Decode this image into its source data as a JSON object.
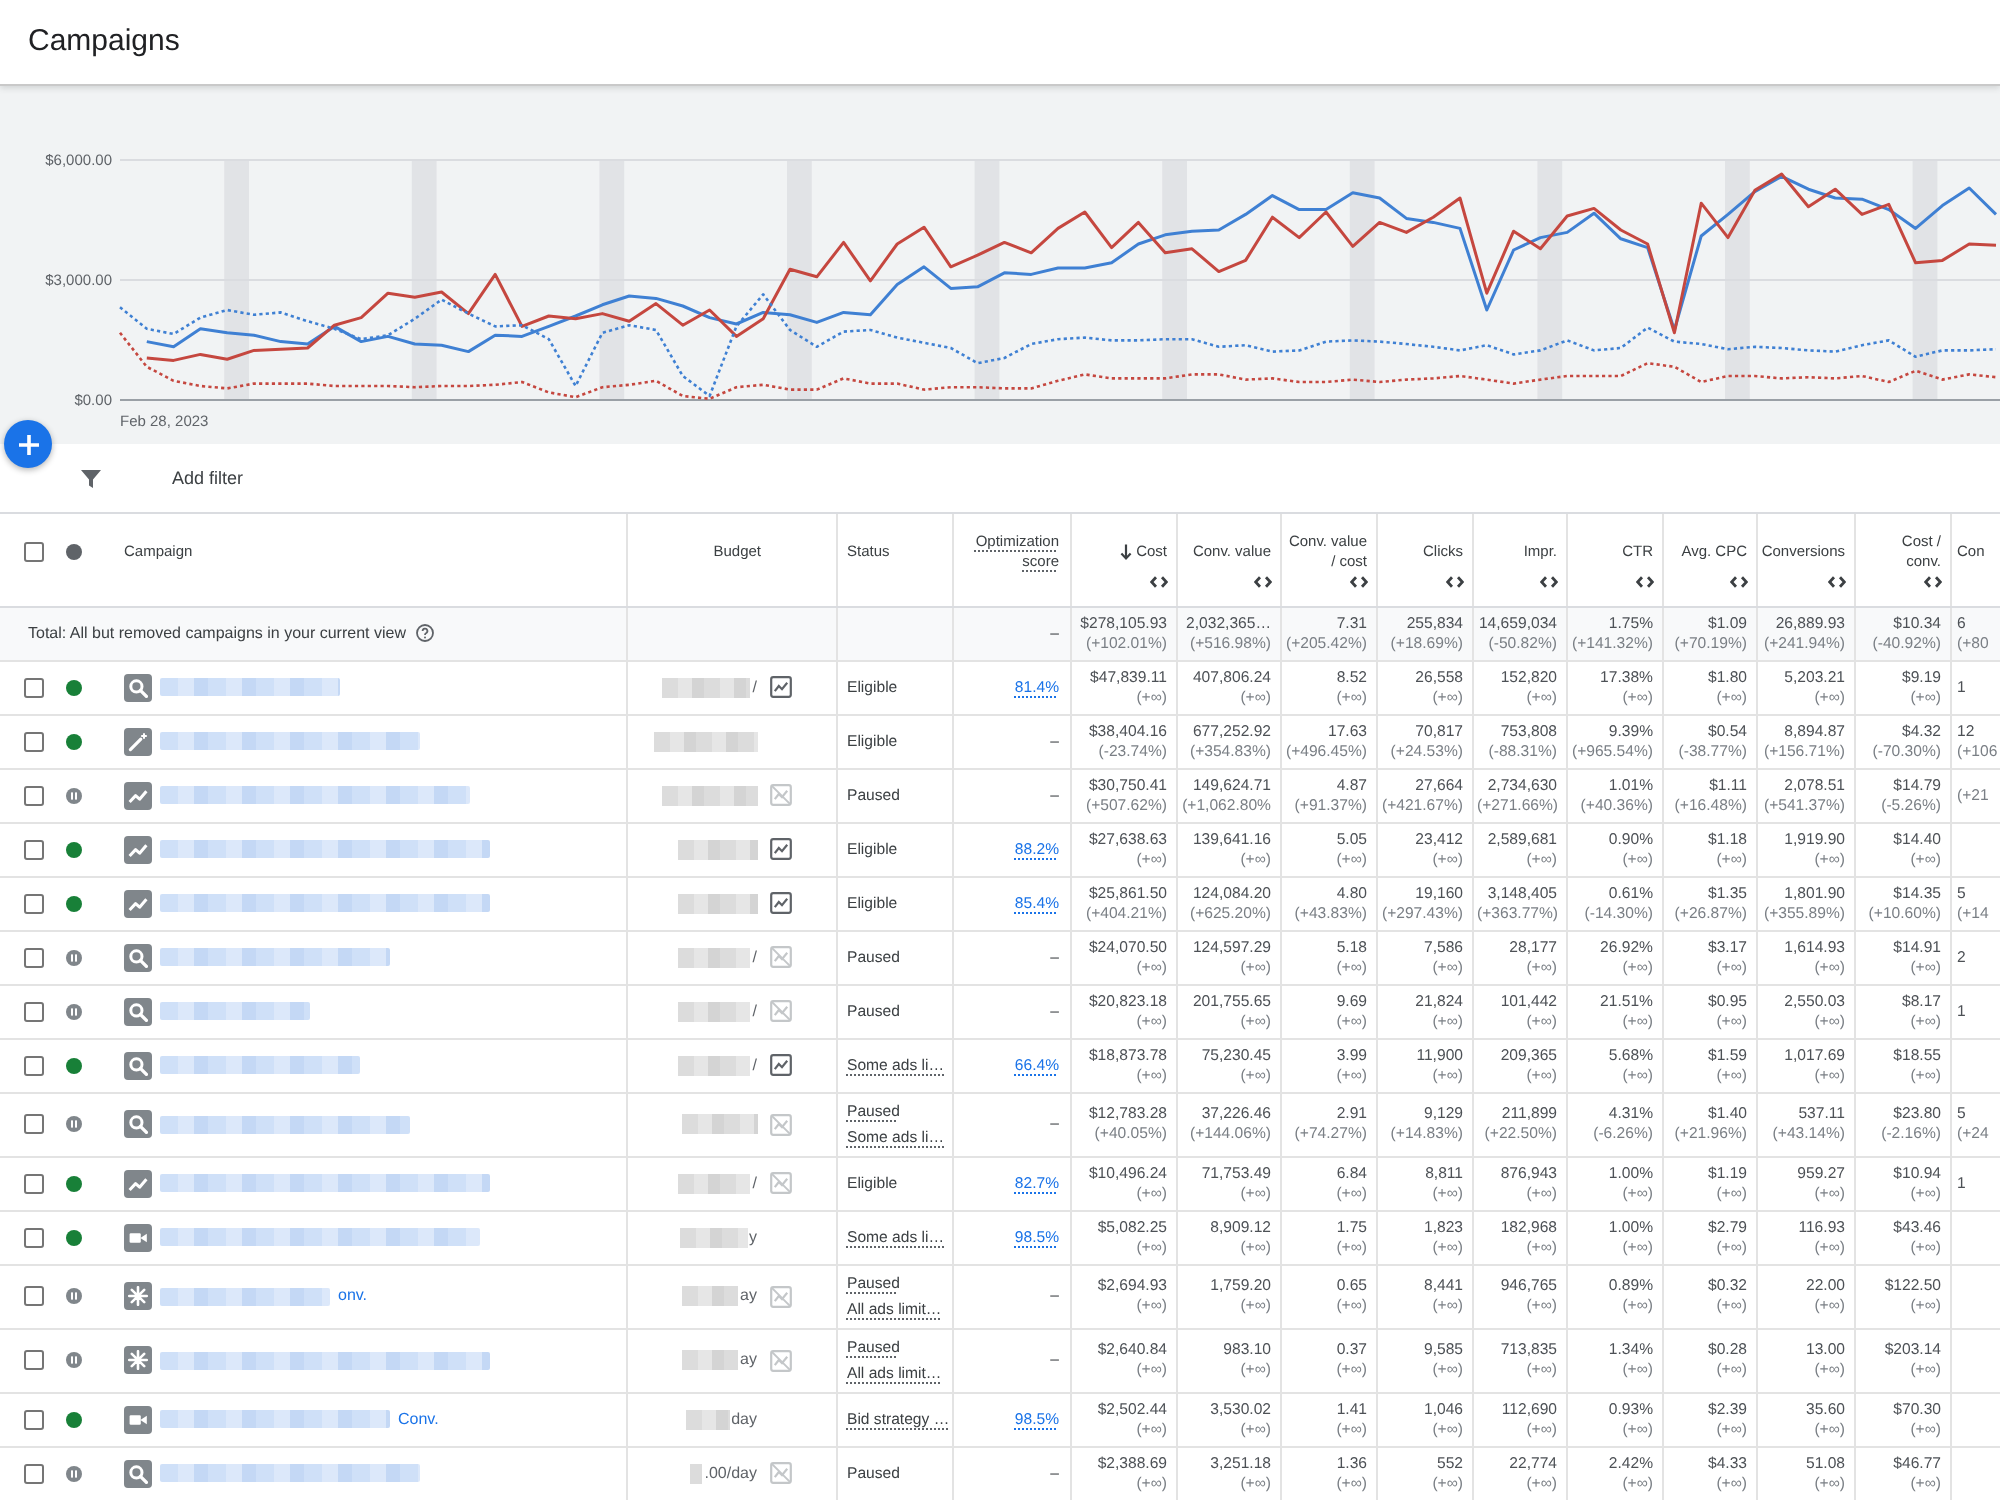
{
  "page": {
    "title": "Campaigns"
  },
  "chart": {
    "first_date": "Feb 28, 2023",
    "chart_data": {
      "type": "line",
      "ylim": [
        0,
        6000
      ],
      "yticks": [
        {
          "value": 0,
          "label": "$0.00"
        },
        {
          "value": 3000,
          "label": "$3,000.00"
        },
        {
          "value": 6000,
          "label": "$6,000.00"
        }
      ],
      "series": [
        {
          "color": "#3f80d3",
          "line_style": "solid",
          "values": [
            null,
            1460,
            1330,
            1780,
            1680,
            1620,
            1460,
            1400,
            1840,
            1460,
            1590,
            1400,
            1370,
            1210,
            1620,
            1590,
            1840,
            2100,
            2380,
            2600,
            2540,
            2350,
            2060,
            1900,
            2190,
            2130,
            1940,
            2190,
            2130,
            2890,
            3330,
            2790,
            2830,
            3180,
            3140,
            3300,
            3300,
            3430,
            3900,
            4130,
            4220,
            4250,
            4640,
            5110,
            4760,
            4760,
            5180,
            5050,
            4540,
            4440,
            4290,
            2250,
            3750,
            4060,
            4190,
            4670,
            4030,
            3810,
            1750,
            4100,
            4640,
            5210,
            5590,
            5270,
            5050,
            5020,
            4760,
            4290,
            4860,
            5300,
            4640
          ]
        },
        {
          "color": "#c5473f",
          "line_style": "solid",
          "values": [
            null,
            1050,
            990,
            1140,
            1020,
            1240,
            1270,
            1300,
            1870,
            2060,
            2670,
            2570,
            2700,
            2160,
            3140,
            1840,
            2100,
            2030,
            2160,
            1970,
            2410,
            1870,
            2250,
            1590,
            2030,
            3270,
            3080,
            3940,
            2980,
            3900,
            4320,
            3330,
            3620,
            3940,
            3680,
            4290,
            4700,
            3810,
            4440,
            3680,
            3780,
            3210,
            3490,
            4570,
            4060,
            4700,
            3840,
            4440,
            4190,
            4570,
            5050,
            2670,
            4220,
            3780,
            4600,
            4790,
            4250,
            3900,
            1680,
            4920,
            4060,
            5240,
            5650,
            4830,
            5270,
            4640,
            4890,
            3430,
            3490,
            3900,
            3870
          ]
        },
        {
          "color": "#3f80d3",
          "line_style": "dotted",
          "values": [
            2320,
            1780,
            1650,
            2060,
            2250,
            2130,
            2190,
            1970,
            1780,
            1520,
            1620,
            2030,
            2510,
            2160,
            1840,
            1870,
            1520,
            350,
            1680,
            1870,
            1750,
            600,
            100,
            1840,
            2640,
            1750,
            1330,
            1710,
            1750,
            1560,
            1430,
            1300,
            920,
            1050,
            1400,
            1520,
            1560,
            1490,
            1490,
            1520,
            1520,
            1330,
            1370,
            1210,
            1240,
            1460,
            1490,
            1460,
            1400,
            1330,
            1240,
            1370,
            1140,
            1240,
            1490,
            1240,
            1300,
            1810,
            1460,
            1400,
            1270,
            1330,
            1300,
            1240,
            1210,
            1370,
            1490,
            1080,
            1240,
            1240,
            1270
          ]
        },
        {
          "color": "#c5473f",
          "line_style": "dotted",
          "values": [
            1680,
            830,
            480,
            350,
            290,
            410,
            410,
            410,
            350,
            350,
            350,
            320,
            350,
            350,
            380,
            450,
            190,
            70,
            320,
            380,
            480,
            100,
            30,
            320,
            380,
            260,
            260,
            540,
            410,
            410,
            260,
            320,
            320,
            290,
            290,
            480,
            640,
            540,
            540,
            540,
            640,
            640,
            510,
            540,
            450,
            450,
            510,
            450,
            510,
            540,
            600,
            510,
            410,
            510,
            600,
            600,
            600,
            920,
            830,
            450,
            600,
            600,
            540,
            570,
            540,
            600,
            450,
            730,
            510,
            640,
            570
          ]
        }
      ]
    }
  },
  "filter_bar": {
    "add_filter": "Add filter"
  },
  "table": {
    "select_all": {
      "checked": false
    },
    "columns": [
      {
        "label": "Campaign",
        "has_tooltip": false,
        "sorted": false,
        "expandable": false
      },
      {
        "label": "Budget",
        "has_tooltip": false,
        "sorted": false,
        "expandable": false
      },
      {
        "label": "Status",
        "has_tooltip": false,
        "sorted": false,
        "expandable": false
      },
      {
        "label": "Optimization score",
        "has_tooltip": true,
        "sorted": false,
        "expandable": false
      },
      {
        "label": "Cost",
        "has_tooltip": false,
        "sorted": true,
        "expandable": true
      },
      {
        "label": "Conv. value",
        "has_tooltip": false,
        "sorted": false,
        "expandable": true
      },
      {
        "label": "Conv. value / cost",
        "has_tooltip": false,
        "sorted": false,
        "expandable": true
      },
      {
        "label": "Clicks",
        "has_tooltip": false,
        "sorted": false,
        "expandable": true
      },
      {
        "label": "Impr.",
        "has_tooltip": false,
        "sorted": false,
        "expandable": true
      },
      {
        "label": "CTR",
        "has_tooltip": false,
        "sorted": false,
        "expandable": true
      },
      {
        "label": "Avg. CPC",
        "has_tooltip": false,
        "sorted": false,
        "expandable": true
      },
      {
        "label": "Conversions",
        "has_tooltip": false,
        "sorted": false,
        "expandable": true
      },
      {
        "label": "Cost / conv.",
        "has_tooltip": false,
        "sorted": false,
        "expandable": true
      },
      {
        "label": "Con",
        "has_tooltip": false,
        "sorted": false,
        "expandable": false
      }
    ],
    "totals": {
      "label": "Total: All but removed campaigns in your current view",
      "optimization_score": "–",
      "metrics": [
        {
          "value": "$278,105.93",
          "change": "(+102.01%)"
        },
        {
          "value": "2,032,365…",
          "change": "(+516.98%)"
        },
        {
          "value": "7.31",
          "change": "(+205.42%)"
        },
        {
          "value": "255,834",
          "change": "(+18.69%)"
        },
        {
          "value": "14,659,034",
          "change": "(-50.82%)"
        },
        {
          "value": "1.75%",
          "change": "(+141.32%)"
        },
        {
          "value": "$1.09",
          "change": "(+70.19%)"
        },
        {
          "value": "26,889.93",
          "change": "(+241.94%)"
        },
        {
          "value": "$10.34",
          "change": "(-40.92%)"
        },
        {
          "value": "6",
          "change": "(+80"
        }
      ]
    },
    "rows": [
      {
        "checked": false,
        "enabled": true,
        "type_icon": {
          "kind": "magnifier"
        },
        "budget_fragment": "/",
        "budget_chart": {
          "enabled": true
        },
        "status": [
          {
            "text": "Eligible",
            "has_tooltip": false
          }
        ],
        "optimization_score": {
          "text": "81.4%",
          "link": true
        },
        "metrics": [
          {
            "value": "$47,839.11",
            "change": "(+∞)"
          },
          {
            "value": "407,806.24",
            "change": "(+∞)"
          },
          {
            "value": "8.52",
            "change": "(+∞)"
          },
          {
            "value": "26,558",
            "change": "(+∞)"
          },
          {
            "value": "152,820",
            "change": "(+∞)"
          },
          {
            "value": "17.38%",
            "change": "(+∞)"
          },
          {
            "value": "$1.80",
            "change": "(+∞)"
          },
          {
            "value": "5,203.21",
            "change": "(+∞)"
          },
          {
            "value": "$9.19",
            "change": "(+∞)"
          },
          {
            "value": "1"
          }
        ]
      },
      {
        "checked": false,
        "enabled": true,
        "type_icon": {
          "kind": "wand"
        },
        "status": [
          {
            "text": "Eligible",
            "has_tooltip": false
          }
        ],
        "optimization_score": {
          "text": "–",
          "link": false
        },
        "metrics": [
          {
            "value": "$38,404.16",
            "change": "(-23.74%)"
          },
          {
            "value": "677,252.92",
            "change": "(+354.83%)"
          },
          {
            "value": "17.63",
            "change": "(+496.45%)"
          },
          {
            "value": "70,817",
            "change": "(+24.53%)"
          },
          {
            "value": "753,808",
            "change": "(-88.31%)"
          },
          {
            "value": "9.39%",
            "change": "(+965.54%)"
          },
          {
            "value": "$0.54",
            "change": "(-38.77%)"
          },
          {
            "value": "8,894.87",
            "change": "(+156.71%)"
          },
          {
            "value": "$4.32",
            "change": "(-70.30%)"
          },
          {
            "value": "12",
            "change": "(+106"
          }
        ]
      },
      {
        "checked": false,
        "enabled": false,
        "type_icon": {
          "kind": "trend"
        },
        "budget_chart": {
          "enabled": false
        },
        "status": [
          {
            "text": "Paused",
            "has_tooltip": false
          }
        ],
        "optimization_score": {
          "text": "–",
          "link": false
        },
        "metrics": [
          {
            "value": "$30,750.41",
            "change": "(+507.62%)"
          },
          {
            "value": "149,624.71",
            "change": "(+1,062.80%"
          },
          {
            "value": "4.87",
            "change": "(+91.37%)"
          },
          {
            "value": "27,664",
            "change": "(+421.67%)"
          },
          {
            "value": "2,734,630",
            "change": "(+271.66%)"
          },
          {
            "value": "1.01%",
            "change": "(+40.36%)"
          },
          {
            "value": "$1.11",
            "change": "(+16.48%)"
          },
          {
            "value": "2,078.51",
            "change": "(+541.37%)"
          },
          {
            "value": "$14.79",
            "change": "(-5.26%)"
          },
          {
            "change": "(+21"
          }
        ]
      },
      {
        "checked": false,
        "enabled": true,
        "type_icon": {
          "kind": "trend"
        },
        "budget_chart": {
          "enabled": true
        },
        "status": [
          {
            "text": "Eligible",
            "has_tooltip": false
          }
        ],
        "optimization_score": {
          "text": "88.2%",
          "link": true
        },
        "metrics": [
          {
            "value": "$27,638.63",
            "change": "(+∞)"
          },
          {
            "value": "139,641.16",
            "change": "(+∞)"
          },
          {
            "value": "5.05",
            "change": "(+∞)"
          },
          {
            "value": "23,412",
            "change": "(+∞)"
          },
          {
            "value": "2,589,681",
            "change": "(+∞)"
          },
          {
            "value": "0.90%",
            "change": "(+∞)"
          },
          {
            "value": "$1.18",
            "change": "(+∞)"
          },
          {
            "value": "1,919.90",
            "change": "(+∞)"
          },
          {
            "value": "$14.40",
            "change": "(+∞)"
          }
        ]
      },
      {
        "checked": false,
        "enabled": true,
        "type_icon": {
          "kind": "trend"
        },
        "budget_chart": {
          "enabled": true
        },
        "status": [
          {
            "text": "Eligible",
            "has_tooltip": false
          }
        ],
        "optimization_score": {
          "text": "85.4%",
          "link": true
        },
        "metrics": [
          {
            "value": "$25,861.50",
            "change": "(+404.21%)"
          },
          {
            "value": "124,084.20",
            "change": "(+625.20%)"
          },
          {
            "value": "4.80",
            "change": "(+43.83%)"
          },
          {
            "value": "19,160",
            "change": "(+297.43%)"
          },
          {
            "value": "3,148,405",
            "change": "(+363.77%)"
          },
          {
            "value": "0.61%",
            "change": "(-14.30%)"
          },
          {
            "value": "$1.35",
            "change": "(+26.87%)"
          },
          {
            "value": "1,801.90",
            "change": "(+355.89%)"
          },
          {
            "value": "$14.35",
            "change": "(+10.60%)"
          },
          {
            "value": "5",
            "change": "(+14"
          }
        ]
      },
      {
        "checked": false,
        "enabled": false,
        "type_icon": {
          "kind": "magnifier"
        },
        "budget_fragment": "/",
        "budget_chart": {
          "enabled": false
        },
        "status": [
          {
            "text": "Paused",
            "has_tooltip": false
          }
        ],
        "optimization_score": {
          "text": "–",
          "link": false
        },
        "metrics": [
          {
            "value": "$24,070.50",
            "change": "(+∞)"
          },
          {
            "value": "124,597.29",
            "change": "(+∞)"
          },
          {
            "value": "5.18",
            "change": "(+∞)"
          },
          {
            "value": "7,586",
            "change": "(+∞)"
          },
          {
            "value": "28,177",
            "change": "(+∞)"
          },
          {
            "value": "26.92%",
            "change": "(+∞)"
          },
          {
            "value": "$3.17",
            "change": "(+∞)"
          },
          {
            "value": "1,614.93",
            "change": "(+∞)"
          },
          {
            "value": "$14.91",
            "change": "(+∞)"
          },
          {
            "value": "2"
          }
        ]
      },
      {
        "checked": false,
        "enabled": false,
        "type_icon": {
          "kind": "magnifier"
        },
        "budget_fragment": "/",
        "budget_chart": {
          "enabled": false
        },
        "status": [
          {
            "text": "Paused",
            "has_tooltip": false
          }
        ],
        "optimization_score": {
          "text": "–",
          "link": false
        },
        "metrics": [
          {
            "value": "$20,823.18",
            "change": "(+∞)"
          },
          {
            "value": "201,755.65",
            "change": "(+∞)"
          },
          {
            "value": "9.69",
            "change": "(+∞)"
          },
          {
            "value": "21,824",
            "change": "(+∞)"
          },
          {
            "value": "101,442",
            "change": "(+∞)"
          },
          {
            "value": "21.51%",
            "change": "(+∞)"
          },
          {
            "value": "$0.95",
            "change": "(+∞)"
          },
          {
            "value": "2,550.03",
            "change": "(+∞)"
          },
          {
            "value": "$8.17",
            "change": "(+∞)"
          },
          {
            "value": "1"
          }
        ]
      },
      {
        "checked": false,
        "enabled": true,
        "type_icon": {
          "kind": "magnifier"
        },
        "budget_fragment": "/",
        "budget_chart": {
          "enabled": true
        },
        "status": [
          {
            "text": "Some ads li…",
            "has_tooltip": true
          }
        ],
        "optimization_score": {
          "text": "66.4%",
          "link": true
        },
        "metrics": [
          {
            "value": "$18,873.78",
            "change": "(+∞)"
          },
          {
            "value": "75,230.45",
            "change": "(+∞)"
          },
          {
            "value": "3.99",
            "change": "(+∞)"
          },
          {
            "value": "11,900",
            "change": "(+∞)"
          },
          {
            "value": "209,365",
            "change": "(+∞)"
          },
          {
            "value": "5.68%",
            "change": "(+∞)"
          },
          {
            "value": "$1.59",
            "change": "(+∞)"
          },
          {
            "value": "1,017.69",
            "change": "(+∞)"
          },
          {
            "value": "$18.55",
            "change": "(+∞)"
          }
        ]
      },
      {
        "checked": false,
        "enabled": false,
        "type_icon": {
          "kind": "magnifier"
        },
        "budget_chart": {
          "enabled": false
        },
        "status": [
          {
            "text": "Paused",
            "has_tooltip": true
          },
          {
            "text": "Some ads li…",
            "has_tooltip": true
          }
        ],
        "optimization_score": {
          "text": "–",
          "link": false
        },
        "metrics": [
          {
            "value": "$12,783.28",
            "change": "(+40.05%)"
          },
          {
            "value": "37,226.46",
            "change": "(+144.06%)"
          },
          {
            "value": "2.91",
            "change": "(+74.27%)"
          },
          {
            "value": "9,129",
            "change": "(+14.83%)"
          },
          {
            "value": "211,899",
            "change": "(+22.50%)"
          },
          {
            "value": "4.31%",
            "change": "(-6.26%)"
          },
          {
            "value": "$1.40",
            "change": "(+21.96%)"
          },
          {
            "value": "537.11",
            "change": "(+43.14%)"
          },
          {
            "value": "$23.80",
            "change": "(-2.16%)"
          },
          {
            "value": "5",
            "change": "(+24"
          }
        ]
      },
      {
        "checked": false,
        "enabled": true,
        "type_icon": {
          "kind": "trend"
        },
        "budget_fragment": "/",
        "budget_chart": {
          "enabled": false
        },
        "status": [
          {
            "text": "Eligible",
            "has_tooltip": false
          }
        ],
        "optimization_score": {
          "text": "82.7%",
          "link": true
        },
        "metrics": [
          {
            "value": "$10,496.24",
            "change": "(+∞)"
          },
          {
            "value": "71,753.49",
            "change": "(+∞)"
          },
          {
            "value": "6.84",
            "change": "(+∞)"
          },
          {
            "value": "8,811",
            "change": "(+∞)"
          },
          {
            "value": "876,943",
            "change": "(+∞)"
          },
          {
            "value": "1.00%",
            "change": "(+∞)"
          },
          {
            "value": "$1.19",
            "change": "(+∞)"
          },
          {
            "value": "959.27",
            "change": "(+∞)"
          },
          {
            "value": "$10.94",
            "change": "(+∞)"
          },
          {
            "value": "1"
          }
        ]
      },
      {
        "checked": false,
        "enabled": true,
        "type_icon": {
          "kind": "camera"
        },
        "budget_fragment": "y",
        "status": [
          {
            "text": "Some ads li…",
            "has_tooltip": true
          }
        ],
        "optimization_score": {
          "text": "98.5%",
          "link": true
        },
        "metrics": [
          {
            "value": "$5,082.25",
            "change": "(+∞)"
          },
          {
            "value": "8,909.12",
            "change": "(+∞)"
          },
          {
            "value": "1.75",
            "change": "(+∞)"
          },
          {
            "value": "1,823",
            "change": "(+∞)"
          },
          {
            "value": "182,968",
            "change": "(+∞)"
          },
          {
            "value": "1.00%",
            "change": "(+∞)"
          },
          {
            "value": "$2.79",
            "change": "(+∞)"
          },
          {
            "value": "116.93",
            "change": "(+∞)"
          },
          {
            "value": "$43.46",
            "change": "(+∞)"
          }
        ]
      },
      {
        "checked": false,
        "enabled": false,
        "type_icon": {
          "kind": "sparkle"
        },
        "name_fragment": "onv.",
        "budget_fragment": "ay",
        "budget_chart": {
          "enabled": false
        },
        "status": [
          {
            "text": "Paused",
            "has_tooltip": true
          },
          {
            "text": "All ads limit…",
            "has_tooltip": true
          }
        ],
        "optimization_score": {
          "text": "–",
          "link": false
        },
        "metrics": [
          {
            "value": "$2,694.93",
            "change": "(+∞)"
          },
          {
            "value": "1,759.20",
            "change": "(+∞)"
          },
          {
            "value": "0.65",
            "change": "(+∞)"
          },
          {
            "value": "8,441",
            "change": "(+∞)"
          },
          {
            "value": "946,765",
            "change": "(+∞)"
          },
          {
            "value": "0.89%",
            "change": "(+∞)"
          },
          {
            "value": "$0.32",
            "change": "(+∞)"
          },
          {
            "value": "22.00",
            "change": "(+∞)"
          },
          {
            "value": "$122.50",
            "change": "(+∞)"
          }
        ]
      },
      {
        "checked": false,
        "enabled": false,
        "type_icon": {
          "kind": "sparkle"
        },
        "budget_fragment": "ay",
        "budget_chart": {
          "enabled": false
        },
        "status": [
          {
            "text": "Paused",
            "has_tooltip": true
          },
          {
            "text": "All ads limit…",
            "has_tooltip": true
          }
        ],
        "optimization_score": {
          "text": "–",
          "link": false
        },
        "metrics": [
          {
            "value": "$2,640.84",
            "change": "(+∞)"
          },
          {
            "value": "983.10",
            "change": "(+∞)"
          },
          {
            "value": "0.37",
            "change": "(+∞)"
          },
          {
            "value": "9,585",
            "change": "(+∞)"
          },
          {
            "value": "713,835",
            "change": "(+∞)"
          },
          {
            "value": "1.34%",
            "change": "(+∞)"
          },
          {
            "value": "$0.28",
            "change": "(+∞)"
          },
          {
            "value": "13.00",
            "change": "(+∞)"
          },
          {
            "value": "$203.14",
            "change": "(+∞)"
          }
        ]
      },
      {
        "checked": false,
        "enabled": true,
        "type_icon": {
          "kind": "camera"
        },
        "name_fragment": "Conv.",
        "budget_fragment": "day",
        "status": [
          {
            "text": "Bid strategy …",
            "has_tooltip": true
          }
        ],
        "optimization_score": {
          "text": "98.5%",
          "link": true
        },
        "metrics": [
          {
            "value": "$2,502.44",
            "change": "(+∞)"
          },
          {
            "value": "3,530.02",
            "change": "(+∞)"
          },
          {
            "value": "1.41",
            "change": "(+∞)"
          },
          {
            "value": "1,046",
            "change": "(+∞)"
          },
          {
            "value": "112,690",
            "change": "(+∞)"
          },
          {
            "value": "0.93%",
            "change": "(+∞)"
          },
          {
            "value": "$2.39",
            "change": "(+∞)"
          },
          {
            "value": "35.60",
            "change": "(+∞)"
          },
          {
            "value": "$70.30",
            "change": "(+∞)"
          }
        ]
      },
      {
        "checked": false,
        "enabled": false,
        "type_icon": {
          "kind": "magnifier"
        },
        "budget_fragment": ".00/day",
        "budget_chart": {
          "enabled": false
        },
        "status": [
          {
            "text": "Paused",
            "has_tooltip": false
          }
        ],
        "optimization_score": {
          "text": "–",
          "link": false
        },
        "metrics": [
          {
            "value": "$2,388.69",
            "change": "(+∞)"
          },
          {
            "value": "3,251.18",
            "change": "(+∞)"
          },
          {
            "value": "1.36",
            "change": "(+∞)"
          },
          {
            "value": "552",
            "change": "(+∞)"
          },
          {
            "value": "22,774",
            "change": "(+∞)"
          },
          {
            "value": "2.42%",
            "change": "(+∞)"
          },
          {
            "value": "$4.33",
            "change": "(+∞)"
          },
          {
            "value": "51.08",
            "change": "(+∞)"
          },
          {
            "value": "$46.77",
            "change": "(+∞)"
          }
        ]
      }
    ]
  }
}
